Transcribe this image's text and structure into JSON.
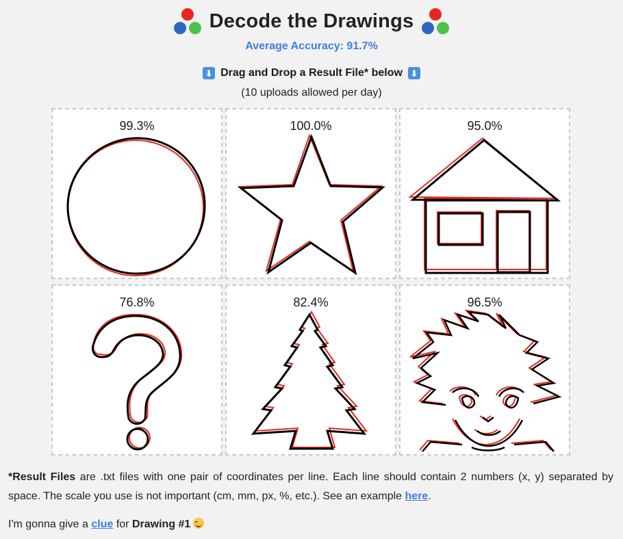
{
  "header": {
    "title": "Decode the Drawings",
    "logo_colors": [
      "#e8261f",
      "#2f66c4",
      "#4cc24a"
    ]
  },
  "accuracy": {
    "text": "Average Accuracy: 91.7%",
    "color": "#3f7de8"
  },
  "upload": {
    "instruction": "Drag and Drop a Result File* below",
    "limit": "(10 uploads allowed per day)",
    "icon": "down-arrow-icon"
  },
  "drawings": [
    {
      "score": "99.3%",
      "shape": "circle"
    },
    {
      "score": "100.0%",
      "shape": "star"
    },
    {
      "score": "95.0%",
      "shape": "house"
    },
    {
      "score": "76.8%",
      "shape": "question-mark"
    },
    {
      "score": "82.4%",
      "shape": "tree"
    },
    {
      "score": "96.5%",
      "shape": "face"
    }
  ],
  "stroke_colors": {
    "reference": "#e8261f",
    "user": "#000000"
  },
  "footer": {
    "result_files_label": "*Result Files",
    "result_files_text": " are .txt files with one pair of coordinates per line. Each line should contain 2 numbers (x, y) separated by space. The scale you use is not important (cm, mm, px, %, etc.). See an example ",
    "here_link": "here",
    "period": ".",
    "clue_prefix": "I'm gonna give a ",
    "clue_link": "clue",
    "clue_mid": " for ",
    "clue_target": "Drawing #1",
    "emoji": "smiling-face-icon"
  }
}
